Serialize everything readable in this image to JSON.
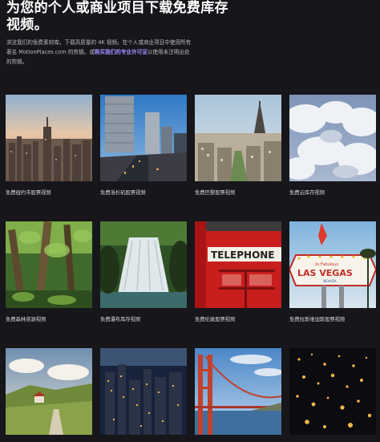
{
  "hero": {
    "title_line1": "为您的个人或商业项目下载免费库存",
    "title_line2": "视频。",
    "desc_part1": "浏览我们的免费素材库。下载高质量的 4K 视频。在个人或商业项目中使用所有著名 MotionPlaces.com 的剪辑。或",
    "desc_link": "购买我们的专业许可证",
    "desc_part2": "以使用未注明出处的剪辑。"
  },
  "videos": [
    {
      "caption": "免费纽约市股票视频",
      "icon": "nyc-skyline-thumbnail"
    },
    {
      "caption": "免费洛杉矶股票视频",
      "icon": "la-downtown-thumbnail"
    },
    {
      "caption": "免费巴黎股票视频",
      "icon": "paris-eiffel-thumbnail"
    },
    {
      "caption": "免费云库存视频",
      "icon": "clouds-thumbnail"
    },
    {
      "caption": "免费森林资源视频",
      "icon": "forest-thumbnail"
    },
    {
      "caption": "免费瀑布库存视频",
      "icon": "waterfall-thumbnail"
    },
    {
      "caption": "免费伦敦股票视频",
      "icon": "london-telephone-thumbnail"
    },
    {
      "caption": "免费拉斯维加斯股票视频",
      "icon": "las-vegas-sign-thumbnail"
    },
    {
      "caption": "",
      "icon": "village-hills-thumbnail"
    },
    {
      "caption": "",
      "icon": "city-night-thumbnail"
    },
    {
      "caption": "",
      "icon": "golden-gate-thumbnail"
    },
    {
      "caption": "",
      "icon": "lanterns-thumbnail"
    }
  ],
  "sign_text": {
    "welcome": "WELCOME",
    "to_fabulous": "to Fabulous",
    "las_vegas": "LAS VEGAS",
    "nevada": "NEVADA",
    "telephone": "TELEPHONE"
  }
}
